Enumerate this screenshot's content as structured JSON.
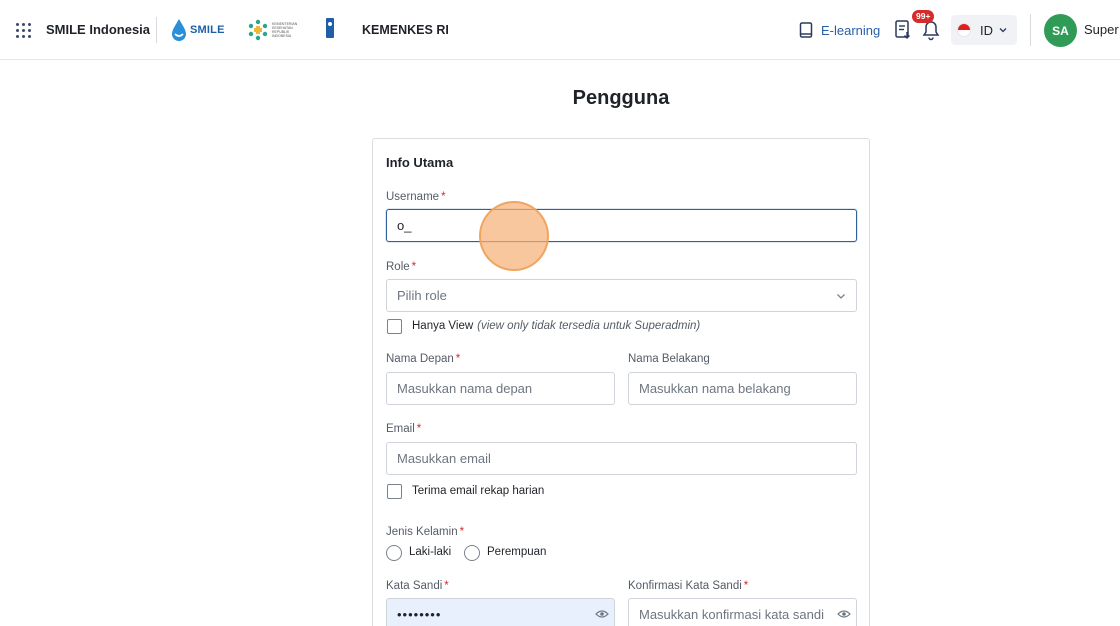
{
  "header": {
    "app_name": "SMILE Indonesia",
    "logo_smile_text": "SMILE",
    "logo_kemkes_text": "KEMENTERIAN KESEHATAN REPUBLIK INDONESIA",
    "org_name": "KEMENKES RI",
    "elearning_label": "E-learning",
    "notification_badge": "99+",
    "language_code": "ID",
    "avatar_initials": "SA",
    "user_name": "Super Admin"
  },
  "page": {
    "title": "Pengguna"
  },
  "form": {
    "section_title": "Info Utama",
    "required_mark": "*",
    "username": {
      "label": "Username",
      "value": "o_"
    },
    "role": {
      "label": "Role",
      "placeholder": "Pilih role"
    },
    "view_only": {
      "label": "Hanya View",
      "note": "(view only tidak tersedia untuk Superadmin)"
    },
    "first_name": {
      "label": "Nama Depan",
      "placeholder": "Masukkan nama depan"
    },
    "last_name": {
      "label": "Nama Belakang",
      "placeholder": "Masukkan nama belakang"
    },
    "email": {
      "label": "Email",
      "placeholder": "Masukkan email"
    },
    "daily_recap": {
      "label": "Terima email rekap harian"
    },
    "gender": {
      "label": "Jenis Kelamin",
      "options": [
        "Laki-laki",
        "Perempuan"
      ]
    },
    "password": {
      "label": "Kata Sandi",
      "value": "••••••••"
    },
    "confirm_password": {
      "label": "Konfirmasi Kata Sandi",
      "placeholder": "Masukkan konfirmasi kata sandi"
    }
  },
  "colors": {
    "accent": "#2f5f9c",
    "required": "#d62b2b",
    "avatar": "#2f9b56",
    "badge": "#d62b2b",
    "autofill": "#e8f0fe"
  },
  "icons": [
    "grid-icon",
    "book-icon",
    "report-icon",
    "bell-icon",
    "chevron-down-icon",
    "eye-icon"
  ]
}
